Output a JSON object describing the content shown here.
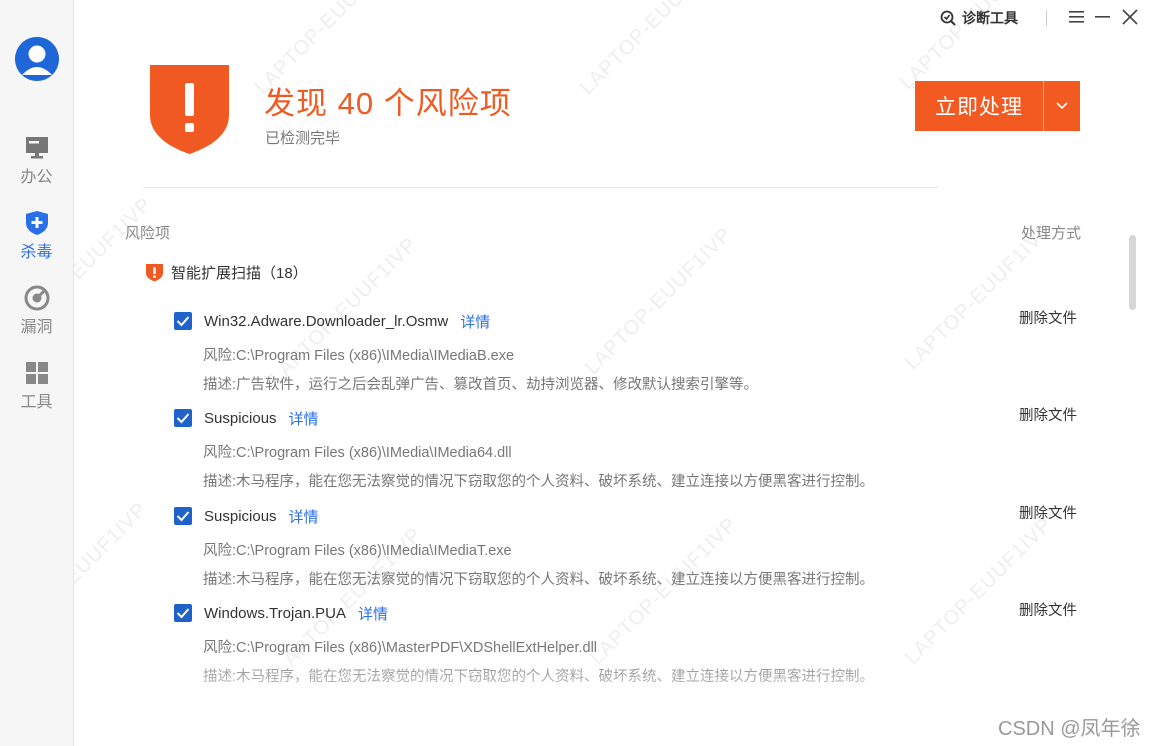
{
  "sidebar": {
    "items": [
      {
        "label": "办公",
        "icon": "monitor-icon",
        "active": false
      },
      {
        "label": "杀毒",
        "icon": "shield-plus-icon",
        "active": true
      },
      {
        "label": "漏洞",
        "icon": "radar-icon",
        "active": false
      },
      {
        "label": "工具",
        "icon": "grid-icon",
        "active": false
      }
    ]
  },
  "titlebar": {
    "diag_tool": "诊断工具"
  },
  "header": {
    "headline": "发现 40 个风险项",
    "subline": "已检测完毕",
    "action_label": "立即处理"
  },
  "table": {
    "col_risk": "风险项",
    "col_handle": "处理方式"
  },
  "group": {
    "title": "智能扩展扫描（18）"
  },
  "items": [
    {
      "name": "Win32.Adware.Downloader_lr.Osmw",
      "detail": "详情",
      "path": "风险:C:\\Program Files (x86)\\IMedia\\IMediaB.exe",
      "desc": "描述:广告软件，运行之后会乱弹广告、篡改首页、劫持浏览器、修改默认搜索引擎等。",
      "action": "删除文件"
    },
    {
      "name": "Suspicious",
      "detail": "详情",
      "path": "风险:C:\\Program Files (x86)\\IMedia\\IMedia64.dll",
      "desc": "描述:木马程序，能在您无法察觉的情况下窃取您的个人资料、破坏系统、建立连接以方便黑客进行控制。",
      "action": "删除文件"
    },
    {
      "name": "Suspicious",
      "detail": "详情",
      "path": "风险:C:\\Program Files (x86)\\IMedia\\IMediaT.exe",
      "desc": "描述:木马程序，能在您无法察觉的情况下窃取您的个人资料、破坏系统、建立连接以方便黑客进行控制。",
      "action": "删除文件"
    },
    {
      "name": "Windows.Trojan.PUA",
      "detail": "详情",
      "path": "风险:C:\\Program Files (x86)\\MasterPDF\\XDShellExtHelper.dll",
      "desc": "描述:木马程序，能在您无法察觉的情况下窃取您的个人资料、破坏系统、建立连接以方便黑客进行控制。",
      "action": "删除文件"
    }
  ],
  "watermark_text": "LAPTOP-EUUF1IVP",
  "csdn": "CSDN @凤年徐",
  "colors": {
    "accent": "#f35a21",
    "link": "#2a6fe8",
    "checkbox": "#1f62c9"
  }
}
